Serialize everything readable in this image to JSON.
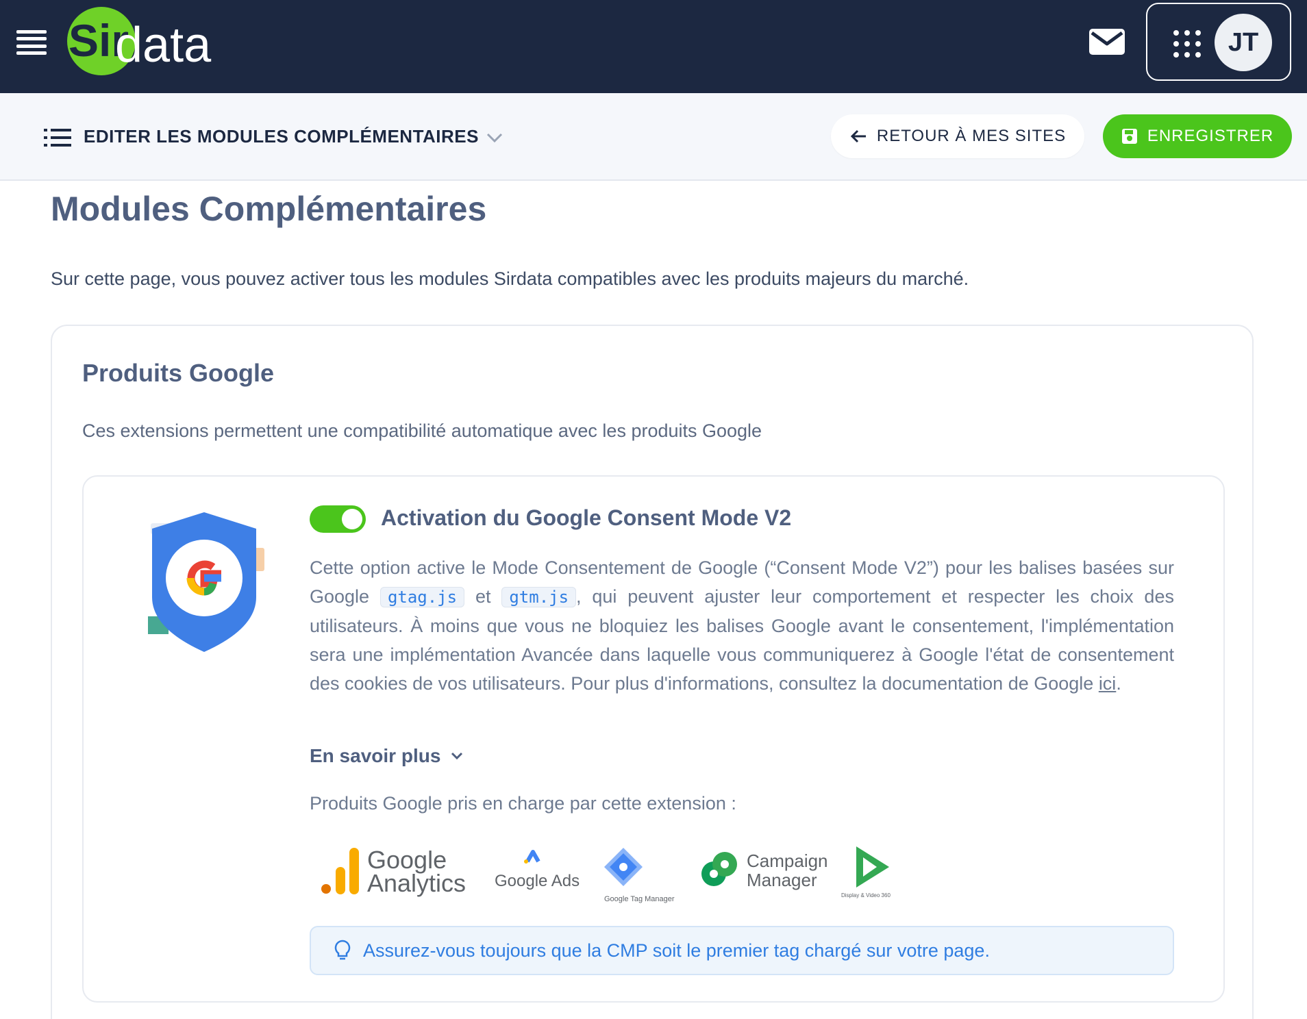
{
  "header": {
    "brand": "Sirdata",
    "user_initials": "JT"
  },
  "subbar": {
    "title": "EDITER LES MODULES COMPLÉMENTAIRES",
    "back_label": "RETOUR À MES SITES",
    "save_label": "ENREGISTRER"
  },
  "page": {
    "title": "Modules Complémentaires",
    "description": "Sur cette page, vous pouvez activer tous les modules Sirdata compatibles avec les produits majeurs du marché."
  },
  "google_card": {
    "title": "Produits Google",
    "description": "Ces extensions permettent une compatibilité automatique avec les produits Google",
    "module": {
      "enabled": true,
      "title": "Activation du Google Consent Mode V2",
      "desc_part1": "Cette option active le Mode Consentement de Google (“Consent Mode V2”) pour les balises basées sur Google",
      "code1": "gtag.js",
      "desc_et": "et",
      "code2": "gtm.js",
      "desc_part2": ", qui peuvent ajuster leur comportement et respecter les choix des utilisateurs. À moins que vous ne bloquiez les balises Google avant le consentement, l'implémentation sera une implémentation Avancée dans laquelle vous communiquerez à Google l'état de consentement des cookies de vos utilisateurs. Pour plus d'informations, consultez la documentation de Google",
      "link_label": "ici",
      "desc_end": ".",
      "learn_more": "En savoir plus",
      "products_label": "Produits Google pris en charge par cette extension :",
      "products": {
        "ga_line1": "Google",
        "ga_line2": "Analytics",
        "ads": "Google Ads",
        "gtm": "Google Tag Manager",
        "cm_line1": "Campaign",
        "cm_line2": "Manager",
        "dv": "Display & Video 360"
      },
      "tip": "Assurez-vous toujours que la CMP soit le premier tag chargé sur votre page."
    }
  },
  "colors": {
    "topbar": "#1c2841",
    "accent_green": "#4bc51c",
    "info_blue": "#2f7de1"
  }
}
